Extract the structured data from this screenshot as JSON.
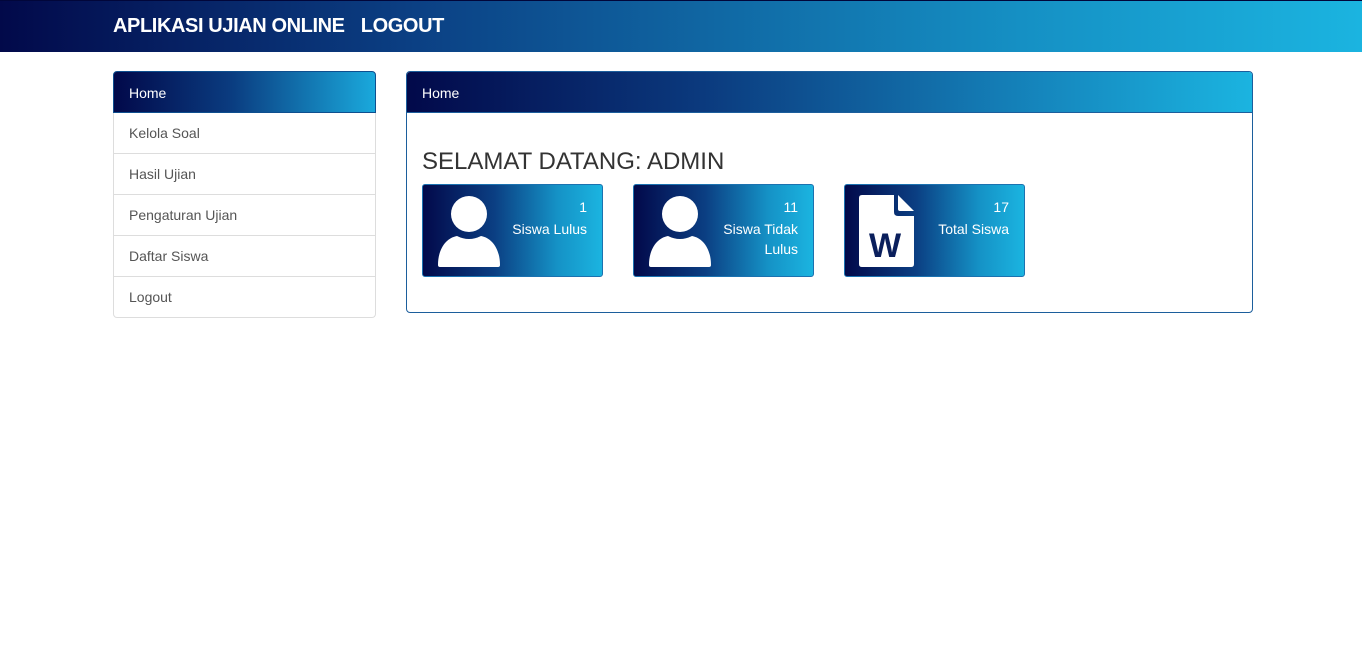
{
  "header": {
    "app_title": "APLIKASI UJIAN ONLINE",
    "logout_label": "LOGOUT"
  },
  "sidebar": {
    "heading": "Home",
    "items": [
      {
        "label": "Kelola Soal"
      },
      {
        "label": "Hasil Ujian"
      },
      {
        "label": "Pengaturan Ujian"
      },
      {
        "label": "Daftar Siswa"
      },
      {
        "label": "Logout"
      }
    ]
  },
  "main": {
    "heading": "Home",
    "welcome": "SELAMAT DATANG: ADMIN",
    "cards": [
      {
        "count": "1",
        "label": "Siswa Lulus",
        "icon": "user-icon"
      },
      {
        "count": "11",
        "label": "Siswa Tidak Lulus",
        "icon": "user-icon"
      },
      {
        "count": "17",
        "label": "Total Siswa",
        "icon": "word-document-icon"
      }
    ]
  },
  "colors": {
    "gradient_dark": "#02094a",
    "gradient_light": "#1bb4e0",
    "panel_border": "#1c5e9c"
  }
}
